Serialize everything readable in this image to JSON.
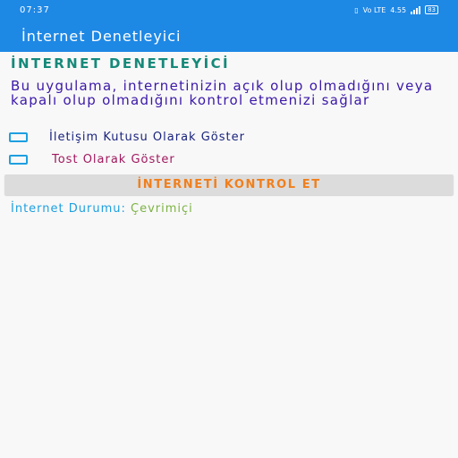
{
  "status_bar": {
    "time": "07:37",
    "network": "Vo LTE",
    "speed": "4.55",
    "battery": "83"
  },
  "app_bar": {
    "title": "İnternet Denetleyici"
  },
  "main": {
    "heading": "İNTERNET DENETLEYİCİ",
    "description": "Bu uygulama, internetinizin açık olup olmadığını veya kapalı olup olmadığını kontrol etmenizi sağlar",
    "option_dialog": {
      "label": "İletişim Kutusu Olarak Göster",
      "checked": false
    },
    "option_toast": {
      "label": "Tost Olarak Göster",
      "checked": false
    },
    "check_button": "İNTERNETİ KONTROL ET",
    "status_label": "İnternet Durumu: ",
    "status_value": "Çevrimiçi"
  },
  "colors": {
    "primary": "#1e88e5",
    "heading": "#15897a",
    "description": "#3b18a8",
    "toast_label": "#a0185e",
    "button_text": "#f07f1c",
    "status_value": "#7cb342"
  }
}
